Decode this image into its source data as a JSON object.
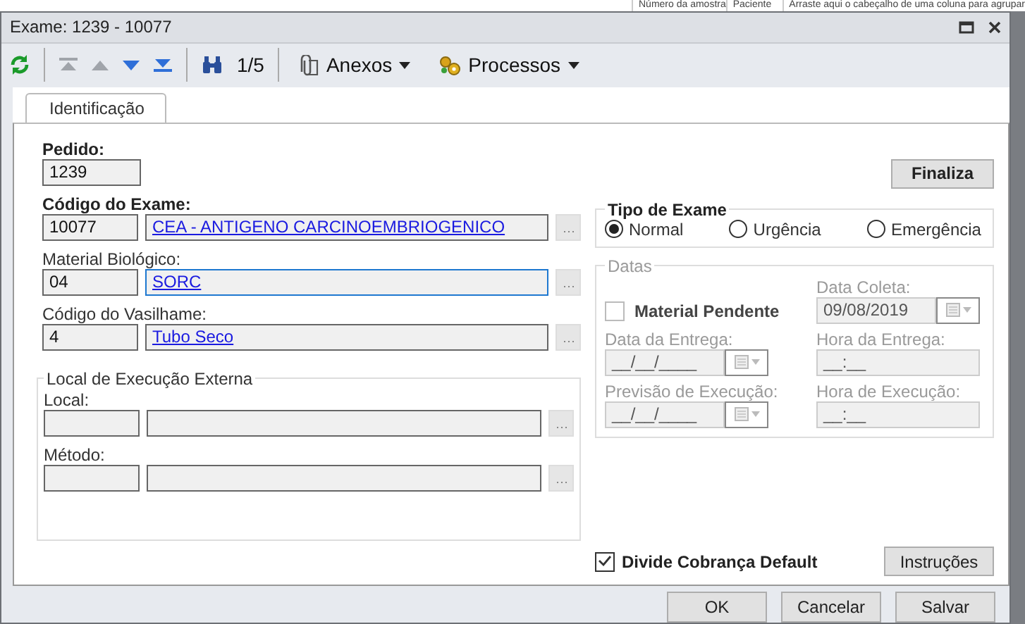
{
  "background": {
    "columns": [
      "Número da amostra",
      "Paciente",
      "Arraste aqui o cabeçalho de uma coluna para agrupar"
    ]
  },
  "window": {
    "title": "Exame: 1239 - 10077"
  },
  "toolbar": {
    "counter": "1/5",
    "menus": [
      {
        "kind": "attach",
        "label": "Anexos"
      },
      {
        "kind": "process",
        "label": "Processos"
      }
    ]
  },
  "tabs": [
    {
      "label": "Identificação",
      "selected": true
    }
  ],
  "pedido": {
    "label": "Pedido:",
    "value": "1239"
  },
  "lookups": [
    {
      "label": "Código do Exame:",
      "bold": true,
      "code": "10077",
      "description": "CEA - ANTIGENO CARCINOEMBRIOGENICO",
      "focused": false
    },
    {
      "label": "Material Biológico:",
      "bold": false,
      "code": "04",
      "description": "SORC",
      "focused": true
    },
    {
      "label": "Código do Vasilhame:",
      "bold": false,
      "code": "4",
      "description": "Tubo Seco",
      "focused": false
    }
  ],
  "local_execucao": {
    "title": "Local de Execução Externa",
    "fields": [
      {
        "label": "Local:"
      },
      {
        "label": "Método:"
      }
    ]
  },
  "finaliza_button": "Finaliza",
  "tipo_exame": {
    "title": "Tipo de Exame",
    "options": [
      {
        "label": "Normal",
        "selected": true
      },
      {
        "label": "Urgência",
        "selected": false
      },
      {
        "label": "Emergência",
        "selected": false
      }
    ]
  },
  "datas": {
    "title": "Datas",
    "disabled": true,
    "material_pendente": {
      "label": "Material Pendente",
      "checked": false
    },
    "fields": [
      {
        "kind": "date",
        "label": "Data Coleta:",
        "value": "09/08/2019"
      },
      {
        "kind": "date",
        "label": "Data da Entrega:",
        "value": "__/__/____"
      },
      {
        "kind": "time",
        "label": "Hora da Entrega:",
        "value": "__:__"
      },
      {
        "kind": "date",
        "label": "Previsão de Execução:",
        "value": "__/__/____"
      },
      {
        "kind": "time",
        "label": "Hora de Execução:",
        "value": "__:__"
      }
    ]
  },
  "divide_cobranca": {
    "label": "Divide Cobrança Default",
    "checked": true
  },
  "instrucoes_button": "Instruções",
  "buttons": [
    "OK",
    "Cancelar",
    "Salvar"
  ]
}
